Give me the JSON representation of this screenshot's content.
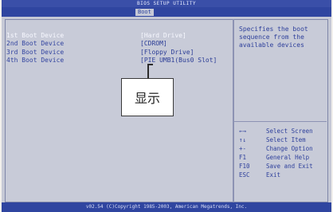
{
  "header": {
    "title": "BIOS SETUP UTILITY",
    "active_tab": "Boot"
  },
  "boot_devices": [
    {
      "label": "1st Boot Device",
      "value": "[Hard Drive]",
      "selected": true
    },
    {
      "label": "2nd Boot Device",
      "value": "[CDROM]",
      "selected": false
    },
    {
      "label": "3rd Boot Device",
      "value": "[Floppy Drive]",
      "selected": false
    },
    {
      "label": "4th Boot Device",
      "value": "[PIE UMB1(Bus0 Slot]",
      "selected": false
    }
  ],
  "help": {
    "description_lines": [
      "Specifies the boot",
      "sequence from the",
      "available devices"
    ],
    "keys": [
      {
        "key": "←→",
        "desc": "Select Screen"
      },
      {
        "key": "↑↓",
        "desc": "Select Item"
      },
      {
        "key": "+-",
        "desc": "Change Option"
      },
      {
        "key": "F1",
        "desc": "General Help"
      },
      {
        "key": "F10",
        "desc": "Save and Exit"
      },
      {
        "key": "ESC",
        "desc": "Exit"
      }
    ]
  },
  "footer": {
    "text": "v02.54 (C)Copyright 1985-2003, American Megatrends, Inc."
  },
  "annotation": {
    "label": "显示"
  },
  "colors": {
    "screen_bg": "#c6c9d6",
    "bar_blue": "#2f45a0",
    "text_blue": "#3345a0"
  }
}
